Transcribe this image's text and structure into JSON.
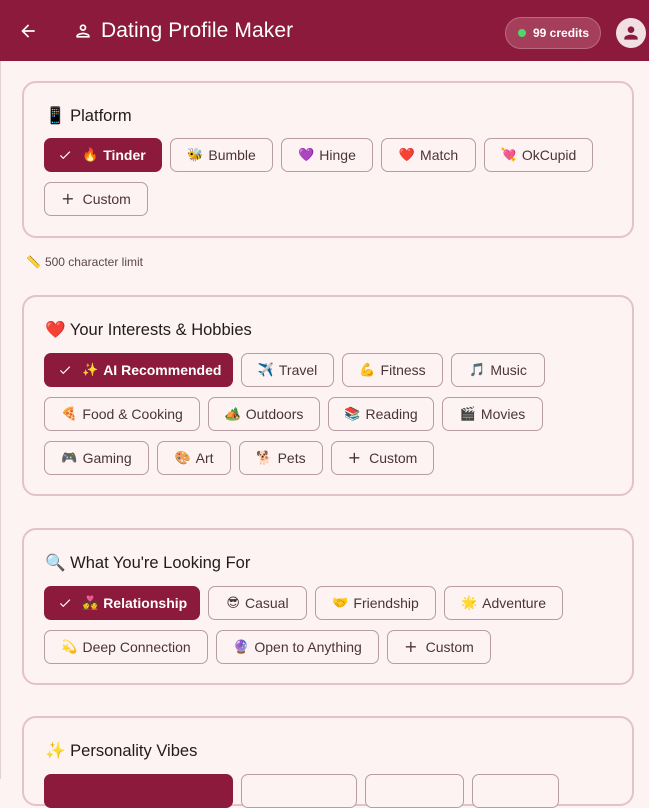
{
  "appbar": {
    "title": "Dating Profile Maker",
    "credits": "99 credits",
    "colors": {
      "primary": "#8c1a3c",
      "credit_dot": "#54d36b"
    }
  },
  "platform": {
    "title_icon": "📱",
    "title": "Platform",
    "options": [
      {
        "emoji": "🔥",
        "label": "Tinder",
        "selected": true
      },
      {
        "emoji": "🐝",
        "label": "Bumble",
        "selected": false
      },
      {
        "emoji": "💜",
        "label": "Hinge",
        "selected": false
      },
      {
        "emoji": "❤️",
        "label": "Match",
        "selected": false
      },
      {
        "emoji": "💘",
        "label": "OkCupid",
        "selected": false
      }
    ],
    "custom_label": "Custom"
  },
  "char_limit": {
    "icon": "📏",
    "text": "500 character limit"
  },
  "interests": {
    "title_icon": "❤️",
    "title": "Your Interests & Hobbies",
    "options": [
      {
        "emoji": "✨",
        "label": "AI Recommended",
        "selected": true
      },
      {
        "emoji": "✈️",
        "label": "Travel",
        "selected": false
      },
      {
        "emoji": "💪",
        "label": "Fitness",
        "selected": false
      },
      {
        "emoji": "🎵",
        "label": "Music",
        "selected": false
      },
      {
        "emoji": "🍕",
        "label": "Food & Cooking",
        "selected": false
      },
      {
        "emoji": "🏕️",
        "label": "Outdoors",
        "selected": false
      },
      {
        "emoji": "📚",
        "label": "Reading",
        "selected": false
      },
      {
        "emoji": "🎬",
        "label": "Movies",
        "selected": false
      },
      {
        "emoji": "🎮",
        "label": "Gaming",
        "selected": false
      },
      {
        "emoji": "🎨",
        "label": "Art",
        "selected": false
      },
      {
        "emoji": "🐕",
        "label": "Pets",
        "selected": false
      }
    ],
    "custom_label": "Custom"
  },
  "looking_for": {
    "title_icon": "🔍",
    "title": "What You're Looking For",
    "options": [
      {
        "emoji": "💑",
        "label": "Relationship",
        "selected": true
      },
      {
        "emoji": "😎",
        "label": "Casual",
        "selected": false
      },
      {
        "emoji": "🤝",
        "label": "Friendship",
        "selected": false
      },
      {
        "emoji": "🌟",
        "label": "Adventure",
        "selected": false
      },
      {
        "emoji": "💫",
        "label": "Deep Connection",
        "selected": false
      },
      {
        "emoji": "🔮",
        "label": "Open to Anything",
        "selected": false
      }
    ],
    "custom_label": "Custom"
  },
  "personality": {
    "title_icon": "✨",
    "title": "Personality Vibes"
  }
}
